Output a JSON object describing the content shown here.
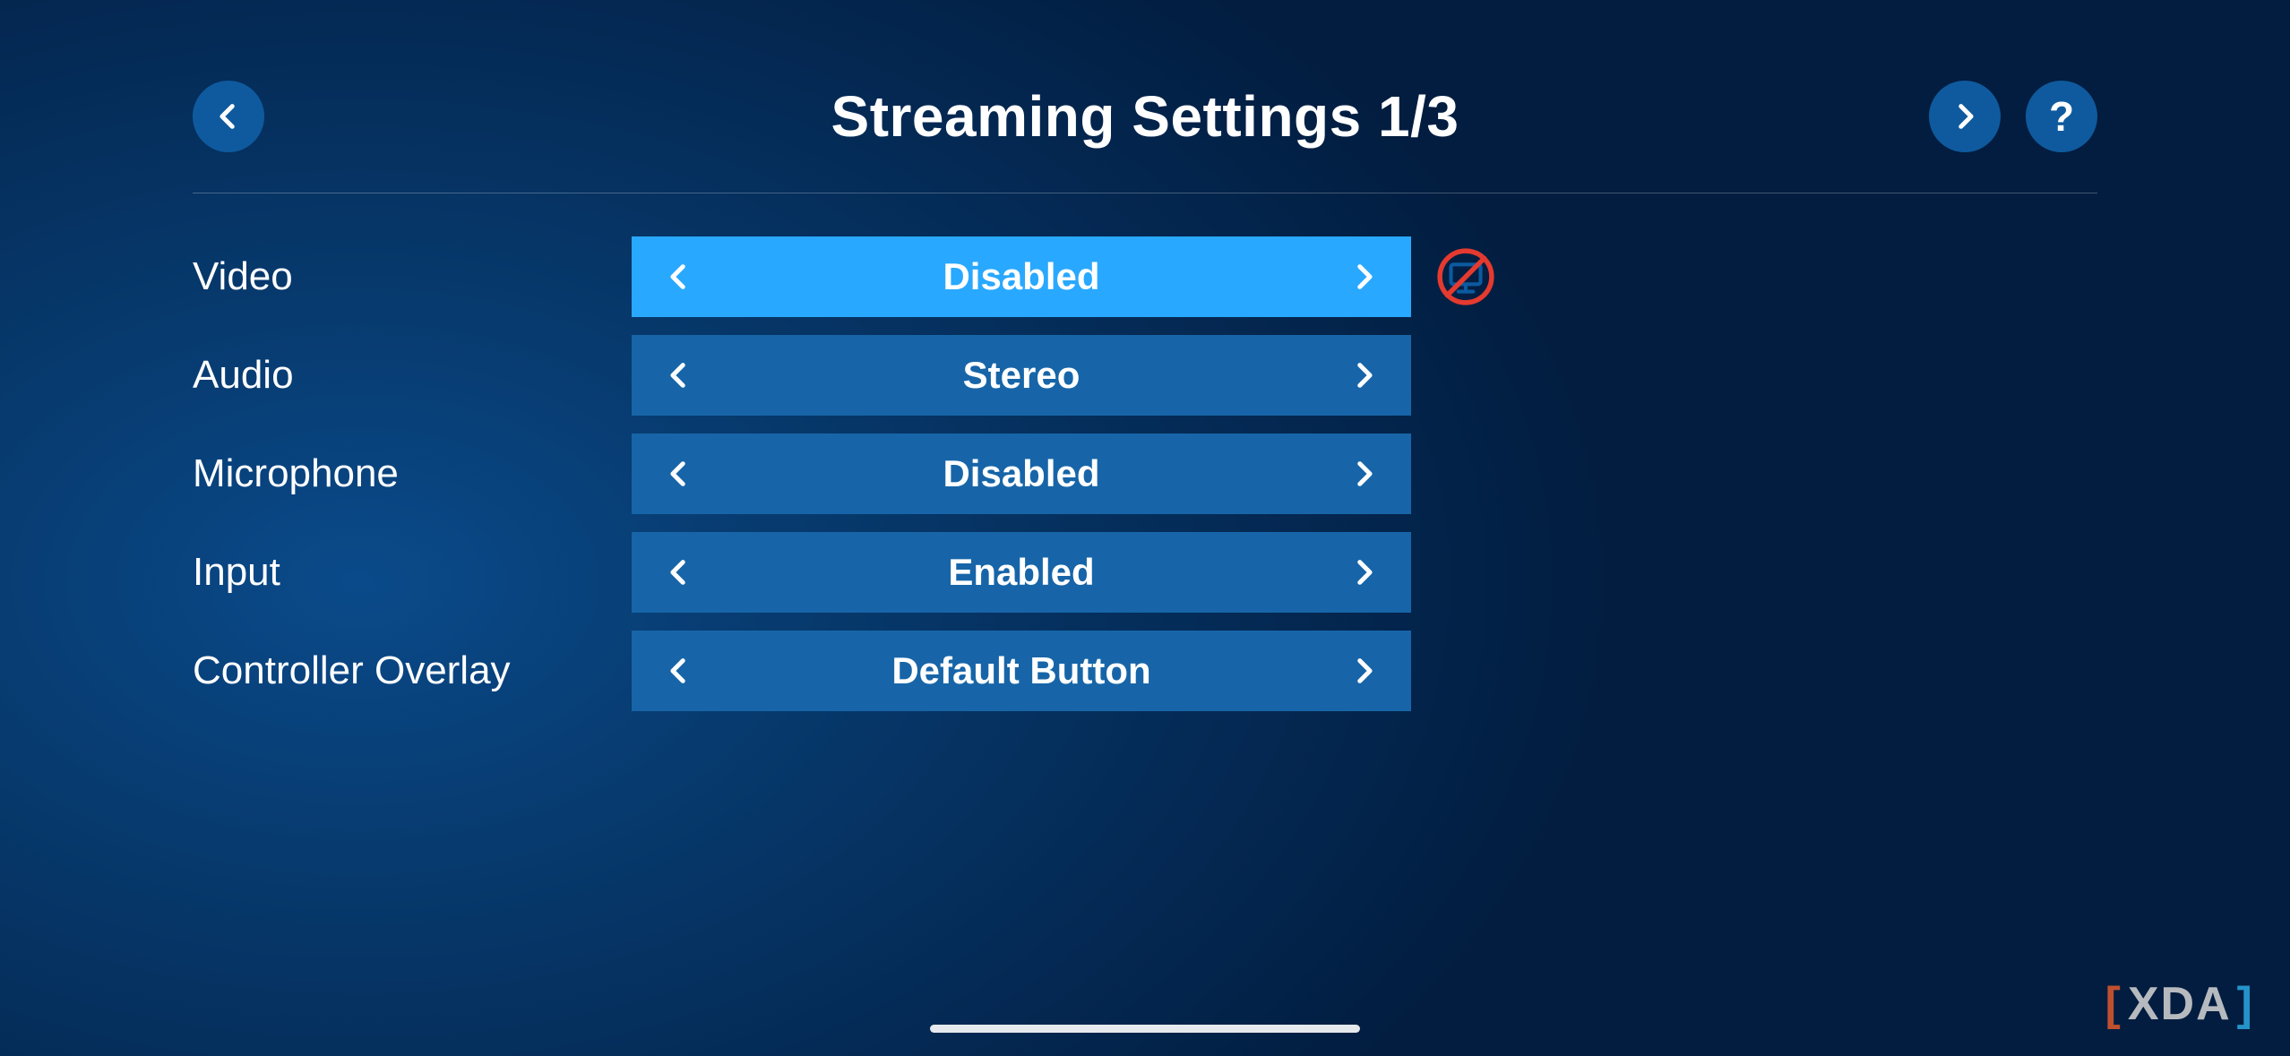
{
  "header": {
    "title": "Streaming Settings 1/3",
    "help_label": "?"
  },
  "rows": [
    {
      "label": "Video",
      "value": "Disabled",
      "active": true,
      "icon": "display-disabled-icon"
    },
    {
      "label": "Audio",
      "value": "Stereo",
      "active": false,
      "icon": null
    },
    {
      "label": "Microphone",
      "value": "Disabled",
      "active": false,
      "icon": null
    },
    {
      "label": "Input",
      "value": "Enabled",
      "active": false,
      "icon": null
    },
    {
      "label": "Controller Overlay",
      "value": "Default Button",
      "active": false,
      "icon": null
    }
  ],
  "watermark": {
    "text": "XDA"
  }
}
